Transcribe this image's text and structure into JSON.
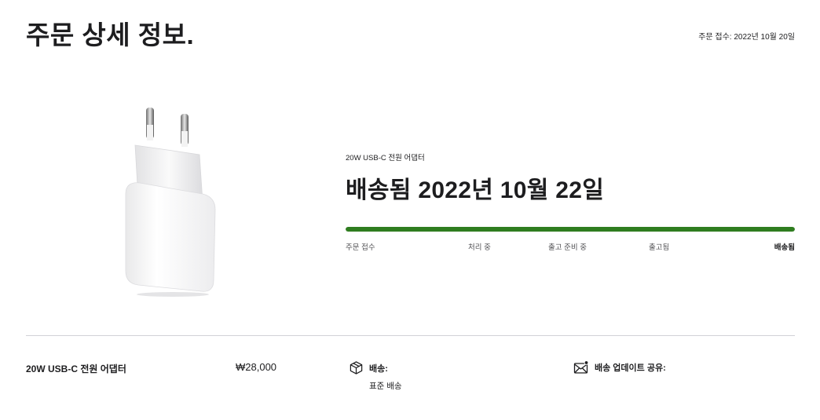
{
  "header": {
    "title": "주문 상세 정보.",
    "order_date": "주문 접수: 2022년 10월 20일"
  },
  "product": {
    "name": "20W USB-C 전원 어댑터",
    "price": "₩28,000"
  },
  "status": {
    "headline": "배송됨 2022년 10월 22일",
    "progress_fraction": 1.0,
    "accent_color": "#2f7d1f",
    "steps": [
      "주문 접수",
      "처리 중",
      "출고 준비 중",
      "출고됨",
      "배송됨"
    ],
    "current_step_index": 4
  },
  "shipping": {
    "icon": "package-icon",
    "label": "배송:",
    "method": "표준 배송"
  },
  "share": {
    "icon": "mail-notification-icon",
    "label": "배송 업데이트 공유:"
  }
}
